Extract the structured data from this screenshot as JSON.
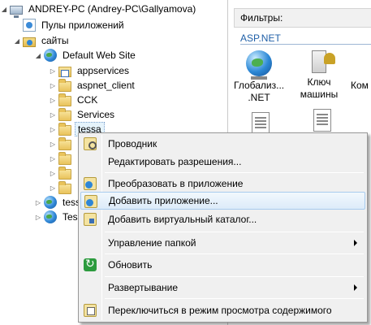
{
  "tree": {
    "server": "ANDREY-PC (Andrey-PC\\Gallyamova)",
    "app_pools": "Пулы приложений",
    "sites": "сайты",
    "default_site": "Default Web Site",
    "children": [
      "appservices",
      "aspnet_client",
      "CCK",
      "Services",
      "tessa"
    ],
    "site_tessa_partial": "tess",
    "site_tes_partial": "Tes"
  },
  "right_pane": {
    "filter_label": "Фильтры:",
    "section": "ASP.NET",
    "features": [
      {
        "line1": "Глобализ...",
        "line2": ".NET",
        "icon": "globe-icon"
      },
      {
        "line1": "Ключ",
        "line2": "машины",
        "icon": "key-icon"
      },
      {
        "line1": "Ком",
        "line2": "",
        "icon": "none"
      }
    ]
  },
  "context_menu": {
    "items": [
      {
        "label": "Проводник",
        "icon": "explorer-icon"
      },
      {
        "label": "Редактировать разрешения...",
        "icon": ""
      },
      {
        "label": "Преобразовать в приложение",
        "icon": "convert-app-icon"
      },
      {
        "label": "Добавить приложение...",
        "icon": "add-app-icon",
        "highlighted": true
      },
      {
        "label": "Добавить виртуальный каталог...",
        "icon": "virtual-dir-icon"
      },
      {
        "label": "Управление папкой",
        "icon": "",
        "submenu": true
      },
      {
        "label": "Обновить",
        "icon": "refresh-icon"
      },
      {
        "label": "Развертывание",
        "icon": "",
        "submenu": true
      },
      {
        "label": "Переключиться в режим просмотра содержимого",
        "icon": "switch-view-icon"
      }
    ]
  }
}
